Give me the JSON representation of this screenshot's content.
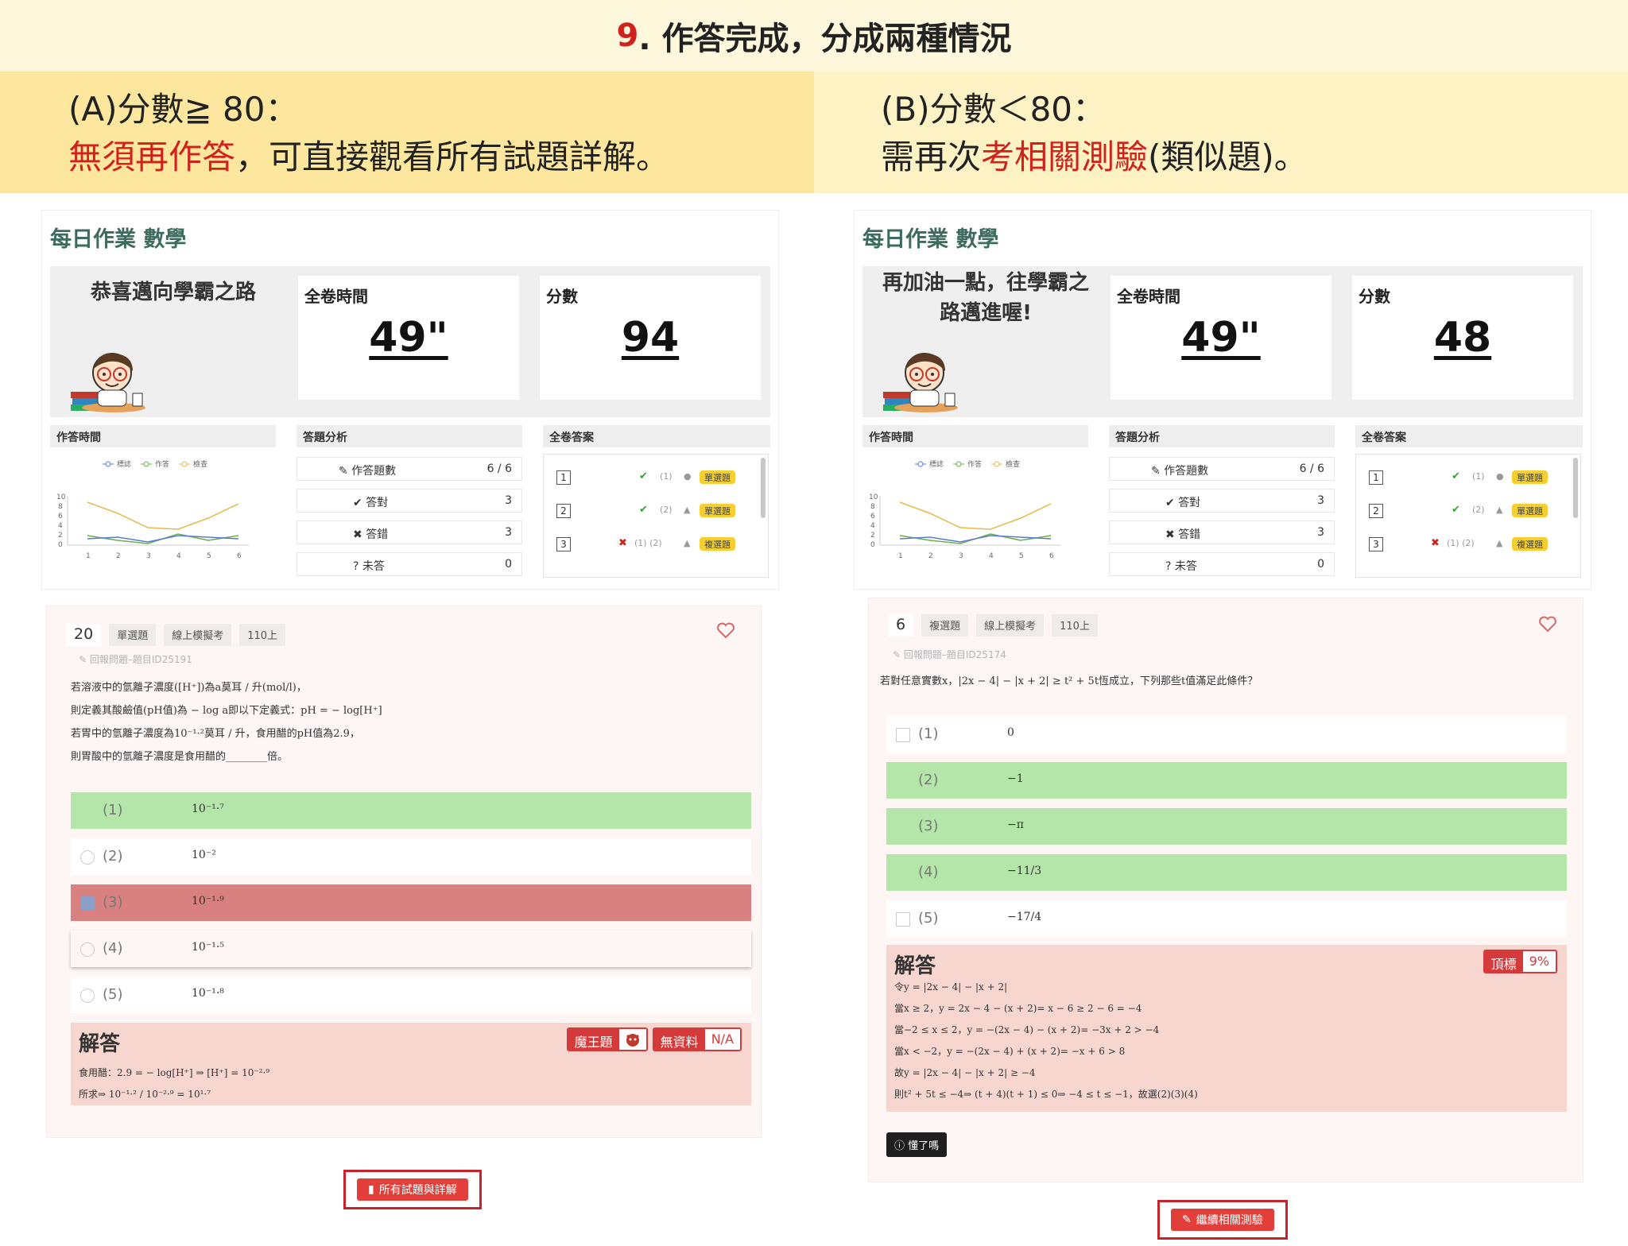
{
  "banner": {
    "num": "9",
    "text": ". 作答完成，分成兩種情況"
  },
  "case_a": {
    "line1": "(A)分數≧ 80：",
    "red": "無須再作答",
    "rest": "，可直接觀看所有試題詳解。"
  },
  "case_b": {
    "line1": "(B)分數＜80：",
    "pre": "需再次",
    "red": "考相關測驗",
    "rest": "(類似題)。"
  },
  "left": {
    "title": "每日作業 數學",
    "greeting": "恭喜邁向學霸之路",
    "time_label": "全卷時間",
    "time_value": "49\"",
    "score_label": "分數",
    "score_value": "94",
    "sec1": "作答時間",
    "sec2": "答題分析",
    "sec3": "全卷答案",
    "legend": [
      "標誌",
      "作答",
      "檢查"
    ],
    "analysis": [
      {
        "label": "作答題數",
        "icon": "✎",
        "value": "6  /  6"
      },
      {
        "label": "答對",
        "icon": "✔",
        "value": "3"
      },
      {
        "label": "答錯",
        "icon": "✖",
        "value": "3"
      },
      {
        "label": "未答",
        "icon": "?",
        "value": "0"
      }
    ],
    "answers": [
      {
        "n": "1",
        "mark": "✔",
        "opt": "(1)",
        "shape": "●",
        "type": "單選題"
      },
      {
        "n": "2",
        "mark": "✔",
        "opt": "(2)",
        "shape": "▲",
        "type": "單選題"
      },
      {
        "n": "3",
        "mark": "✖",
        "opt": "(1)  (2)",
        "shape": "▲",
        "type": "複選題"
      }
    ],
    "question": {
      "num": "20",
      "type": "單選題",
      "source": "線上模擬考",
      "term": "110上",
      "report": "回報問題–題目ID25191",
      "stem": [
        "若溶液中的氫離子濃度([H⁺])為a莫耳 / 升(mol/l)，",
        "則定義其酸鹼值(pH值)為 − log a即以下定義式：pH = − log[H⁺]",
        "若胃中的氫離子濃度為10⁻¹·²莫耳 / 升，食用醋的pH值為2.9，",
        "則胃酸中的氫離子濃度是食用醋的________倍。"
      ],
      "options": [
        {
          "label": "(1)",
          "math": "10⁻¹·⁷"
        },
        {
          "label": "(2)",
          "math": "10⁻²"
        },
        {
          "label": "(3)",
          "math": "10⁻¹·⁹"
        },
        {
          "label": "(4)",
          "math": "10⁻¹·⁵"
        },
        {
          "label": "(5)",
          "math": "10⁻¹·⁸"
        }
      ],
      "sol_title": "解答",
      "badge1_l": "魔王題",
      "badge2_l": "無資料",
      "badge2_r": "N/A",
      "sol_lines": [
        "食用醋：2.9 = − log[H⁺] ⇒ [H⁺] = 10⁻²·⁹",
        "所求⇒ 10⁻¹·² / 10⁻²·⁹ = 10¹·⁷"
      ]
    },
    "cta": "所有試題與詳解"
  },
  "right": {
    "title": "每日作業 數學",
    "greeting": "再加油一點，往學霸之路邁進喔!",
    "time_label": "全卷時間",
    "time_value": "49\"",
    "score_label": "分數",
    "score_value": "48",
    "sec1": "作答時間",
    "sec2": "答題分析",
    "sec3": "全卷答案",
    "legend": [
      "標誌",
      "作答",
      "檢查"
    ],
    "analysis": [
      {
        "label": "作答題數",
        "icon": "✎",
        "value": "6  /  6"
      },
      {
        "label": "答對",
        "icon": "✔",
        "value": "3"
      },
      {
        "label": "答錯",
        "icon": "✖",
        "value": "3"
      },
      {
        "label": "未答",
        "icon": "?",
        "value": "0"
      }
    ],
    "answers": [
      {
        "n": "1",
        "mark": "✔",
        "opt": "(1)",
        "shape": "●",
        "type": "單選題"
      },
      {
        "n": "2",
        "mark": "✔",
        "opt": "(2)",
        "shape": "▲",
        "type": "單選題"
      },
      {
        "n": "3",
        "mark": "✖",
        "opt": "(1)  (2)",
        "shape": "▲",
        "type": "複選題"
      }
    ],
    "question": {
      "num": "6",
      "type": "複選題",
      "source": "線上模擬考",
      "term": "110上",
      "report": "回報問題–題目ID25174",
      "stem": [
        "若對任意實數x，|2x − 4| − |x + 2| ≥ t² + 5t恆成立，下列那些t值滿足此條件？"
      ],
      "options": [
        {
          "label": "(1)",
          "math": "0"
        },
        {
          "label": "(2)",
          "math": "−1"
        },
        {
          "label": "(3)",
          "math": "−π"
        },
        {
          "label": "(4)",
          "math": "−11/3"
        },
        {
          "label": "(5)",
          "math": "−17/4"
        }
      ],
      "sol_title": "解答",
      "badge1_l": "頂標",
      "badge1_r": "9%",
      "sol_lines": [
        "令y = |2x − 4| − |x + 2|",
        "當x ≥ 2，y = 2x − 4 − (x + 2)= x − 6 ≥ 2 − 6 = −4",
        "當−2 ≤ x ≤ 2，y = −(2x − 4) − (x + 2)= −3x + 2 > −4",
        "當x < −2，y = −(2x − 4) + (x + 2)= −x + 6 > 8",
        "故y = |2x − 4| − |x + 2| ≥ −4",
        "則t² + 5t ≤ −4⇒ (t + 4)(t + 1) ≤ 0⇒ −4 ≤ t ≤ −1，故選(2)(3)(4)"
      ],
      "ok": "懂了嗎"
    },
    "cta": "繼續相關測驗"
  }
}
